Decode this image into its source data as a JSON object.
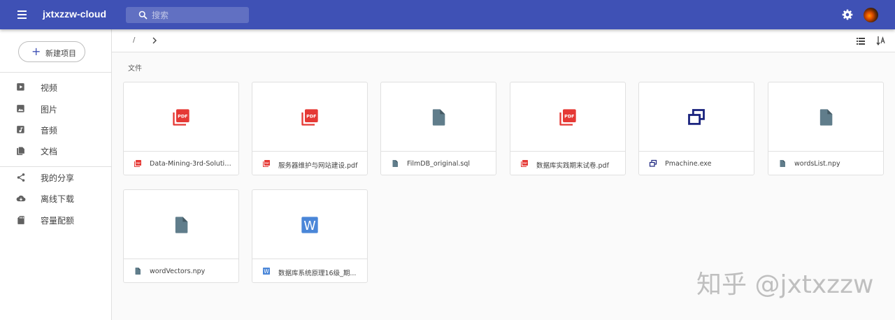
{
  "appbar": {
    "title": "jxtxzzw-cloud",
    "search_placeholder": "搜索",
    "color": "#3f51b5"
  },
  "sidebar": {
    "new_button": "新建项目",
    "items": [
      {
        "label": "视频",
        "icon": "video-icon"
      },
      {
        "label": "图片",
        "icon": "image-icon"
      },
      {
        "label": "音频",
        "icon": "audio-icon"
      },
      {
        "label": "文档",
        "icon": "document-icon"
      },
      {
        "label": "我的分享",
        "icon": "share-icon"
      },
      {
        "label": "离线下载",
        "icon": "cloud-download-icon"
      },
      {
        "label": "容量配额",
        "icon": "sd-card-icon"
      }
    ]
  },
  "breadcrumb": {
    "root": "/"
  },
  "section": {
    "label": "文件"
  },
  "files": [
    {
      "name": "Data-Mining-3rd-Solution...",
      "type": "pdf"
    },
    {
      "name": "服务器维护与网站建设.pdf",
      "type": "pdf"
    },
    {
      "name": "FilmDB_original.sql",
      "type": "file"
    },
    {
      "name": "数据库实践期末试卷.pdf",
      "type": "pdf"
    },
    {
      "name": "Pmachine.exe",
      "type": "exe"
    },
    {
      "name": "wordsList.npy",
      "type": "file"
    },
    {
      "name": "wordVectors.npy",
      "type": "file"
    },
    {
      "name": "数据库系统原理16级_期...",
      "type": "word"
    }
  ],
  "colors": {
    "pdf": "#e53935",
    "file": "#607d8b",
    "exe": "#1a237e",
    "word": "#4a86d8"
  },
  "watermark": "知乎 @jxtxzzw"
}
